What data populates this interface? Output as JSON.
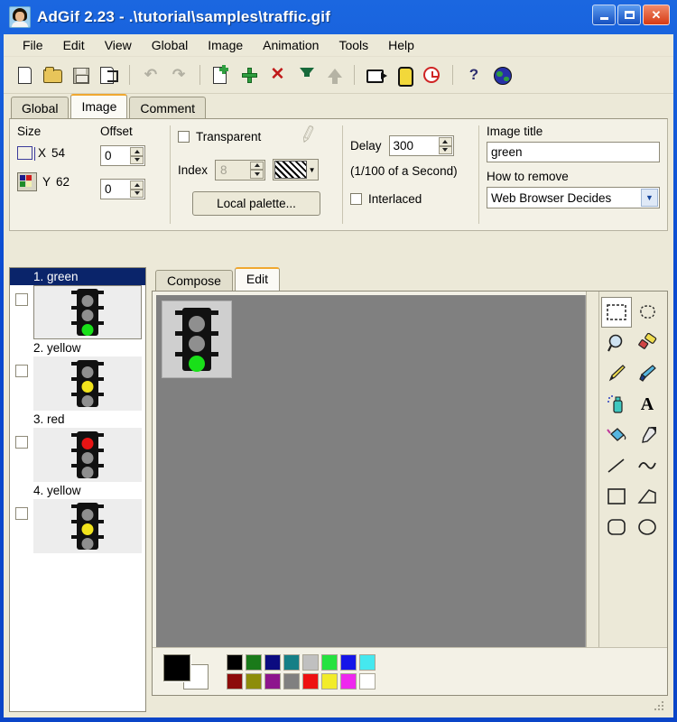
{
  "window": {
    "title": "AdGif 2.23 - .\\tutorial\\samples\\traffic.gif",
    "icon": "app-portrait-icon",
    "buttons": {
      "minimize": "_",
      "maximize": "□",
      "close": "✕"
    }
  },
  "menu": {
    "items": [
      "File",
      "Edit",
      "View",
      "Global",
      "Image",
      "Animation",
      "Tools",
      "Help"
    ]
  },
  "toolbar": {
    "groups": [
      {
        "items": [
          {
            "name": "new-file-icon",
            "enabled": true
          },
          {
            "name": "open-file-icon",
            "enabled": true
          },
          {
            "name": "save-file-icon",
            "enabled": false
          },
          {
            "name": "save-as-icon",
            "enabled": true
          }
        ]
      },
      {
        "items": [
          {
            "name": "undo-icon",
            "enabled": false
          },
          {
            "name": "redo-icon",
            "enabled": false
          }
        ]
      },
      {
        "items": [
          {
            "name": "new-frame-icon",
            "enabled": true
          },
          {
            "name": "add-frame-icon",
            "enabled": true
          },
          {
            "name": "delete-frame-icon",
            "enabled": true
          },
          {
            "name": "move-frame-down-icon",
            "enabled": true
          },
          {
            "name": "move-frame-up-icon",
            "enabled": false
          }
        ]
      },
      {
        "items": [
          {
            "name": "preview-animation-icon",
            "enabled": true
          },
          {
            "name": "optimize-icon",
            "enabled": true
          },
          {
            "name": "timing-icon",
            "enabled": true
          }
        ]
      },
      {
        "items": [
          {
            "name": "help-icon",
            "enabled": true
          },
          {
            "name": "web-icon",
            "enabled": true
          }
        ]
      }
    ]
  },
  "property_tabs": {
    "items": [
      {
        "label": "Global",
        "active": false
      },
      {
        "label": "Image",
        "active": true
      },
      {
        "label": "Comment",
        "active": false
      }
    ]
  },
  "properties": {
    "size": {
      "heading": "Size",
      "x_label": "X",
      "x_value": "54",
      "y_label": "Y",
      "y_value": "62",
      "size_icon": "dimension-icon",
      "palette_icon": "color-palette-icon"
    },
    "offset": {
      "heading": "Offset",
      "x_value": "0",
      "y_value": "0"
    },
    "transparent": {
      "label": "Transparent",
      "checked": false,
      "index_label": "Index",
      "index_value": "8",
      "index_enabled": false,
      "color_preview": "hatched-transparent-swatch",
      "eyedropper_icon": "eyedropper-icon",
      "local_palette_button": "Local palette..."
    },
    "delay": {
      "label": "Delay",
      "value": "300",
      "units": "(1/100 of a Second)",
      "interlaced_label": "Interlaced",
      "interlaced_checked": false
    },
    "image_title": {
      "label": "Image title",
      "value": "green",
      "remove_label": "How to remove",
      "remove_value": "Web Browser Decides"
    }
  },
  "frames": {
    "items": [
      {
        "label": "1. green",
        "lamp": "green",
        "selected": true,
        "checked": false
      },
      {
        "label": "2. yellow",
        "lamp": "yellow",
        "selected": false,
        "checked": false
      },
      {
        "label": "3. red",
        "lamp": "red",
        "selected": false,
        "checked": false
      },
      {
        "label": "4. yellow",
        "lamp": "yellow",
        "selected": false,
        "checked": false
      }
    ]
  },
  "editor_tabs": {
    "items": [
      {
        "label": "Compose",
        "active": false
      },
      {
        "label": "Edit",
        "active": true
      }
    ]
  },
  "canvas": {
    "image_lamp": "green",
    "background_color": "#808080",
    "image_background": "#cfcfcf"
  },
  "tools": {
    "items": [
      {
        "name": "rect-select-icon",
        "active": true
      },
      {
        "name": "lasso-select-icon",
        "active": false
      },
      {
        "name": "magnifier-icon",
        "active": false
      },
      {
        "name": "eraser-icon",
        "active": false
      },
      {
        "name": "pencil-icon",
        "active": false
      },
      {
        "name": "brush-icon",
        "active": false
      },
      {
        "name": "airbrush-icon",
        "active": false
      },
      {
        "name": "text-icon",
        "active": false
      },
      {
        "name": "paint-bucket-icon",
        "active": false
      },
      {
        "name": "eyedropper-icon",
        "active": false
      },
      {
        "name": "line-icon",
        "active": false
      },
      {
        "name": "curve-icon",
        "active": false
      },
      {
        "name": "rectangle-icon",
        "active": false
      },
      {
        "name": "polygon-icon",
        "active": false
      },
      {
        "name": "rounded-rect-icon",
        "active": false
      },
      {
        "name": "ellipse-icon",
        "active": false
      }
    ],
    "text_glyph": "A"
  },
  "palette": {
    "foreground": "#000000",
    "background": "#ffffff",
    "row1": [
      "#000000",
      "#1a7a1a",
      "#0b0b80",
      "#157f86",
      "#c0c0c0",
      "#25e23f",
      "#1515e8",
      "#45e8ef"
    ],
    "row2": [
      "#8d0b0b",
      "#8d8d0b",
      "#8d158d",
      "#808080",
      "#ee1111",
      "#f2ec2a",
      "#ee27ee",
      "#ffffff"
    ]
  }
}
